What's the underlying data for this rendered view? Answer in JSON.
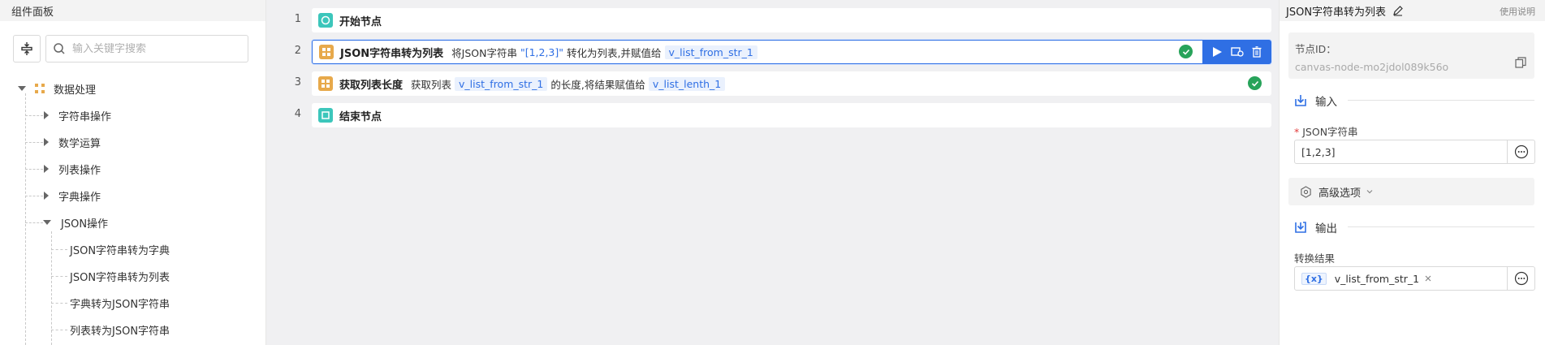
{
  "left_panel": {
    "title": "组件面板",
    "search_placeholder": "输入关键字搜索",
    "tree": {
      "root": "数据处理",
      "groups": [
        "字符串操作",
        "数学运算",
        "列表操作",
        "字典操作",
        "JSON操作"
      ],
      "json_children": [
        "JSON字符串转为字典",
        "JSON字符串转为列表",
        "字典转为JSON字符串",
        "列表转为JSON字符串"
      ]
    }
  },
  "flow": {
    "rows": [
      {
        "num": "1",
        "title": "开始节点"
      },
      {
        "num": "2",
        "title": "JSON字符串转为列表",
        "t1": "将JSON字符串",
        "s1": "\"[1,2,3]\"",
        "t2": "转化为列表,并赋值给",
        "v1": "v_list_from_str_1"
      },
      {
        "num": "3",
        "title": "获取列表长度",
        "t1": "获取列表",
        "v1": "v_list_from_str_1",
        "t2": "的长度,将结果赋值给",
        "v2": "v_list_lenth_1"
      },
      {
        "num": "4",
        "title": "结束节点"
      }
    ]
  },
  "right_panel": {
    "title": "JSON字符串转为列表",
    "help": "使用说明",
    "node_id_label": "节点ID：",
    "node_id": "canvas-node-mo2jdol089k56o",
    "input_label": "输入",
    "json_field_label": "JSON字符串",
    "json_field_value": "[1,2,3]",
    "advanced": "高级选项",
    "output_label": "输出",
    "result_label": "转换结果",
    "result_var_icon": "{x}",
    "result_var": "v_list_from_str_1"
  },
  "colors": {
    "accent": "#2f6fe4",
    "success": "#27a35a",
    "node_teal": "#3cc6bb",
    "node_orange": "#e7a94b"
  }
}
